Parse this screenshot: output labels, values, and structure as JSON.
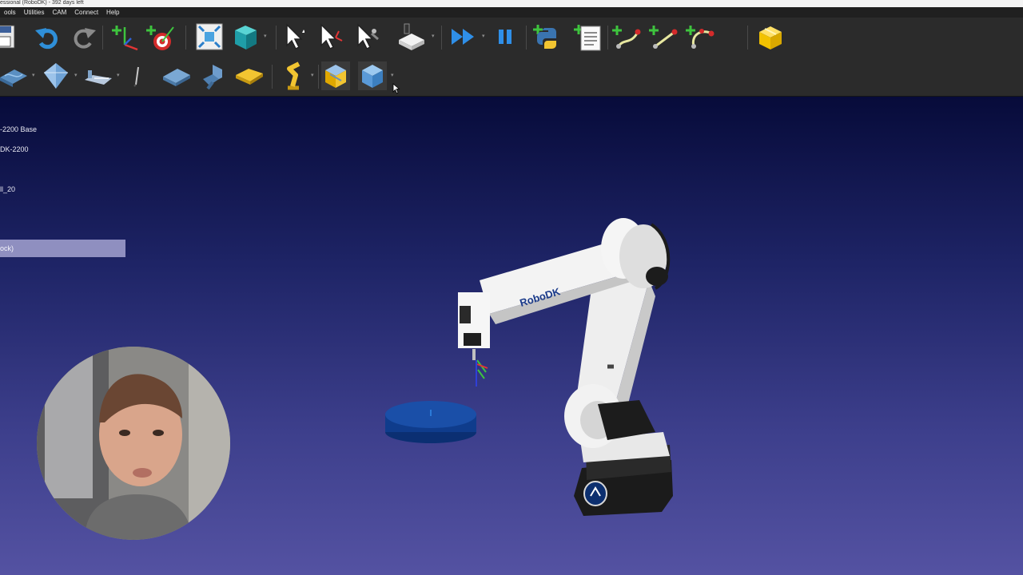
{
  "window": {
    "title": "essional (RoboDK) - 392 days left"
  },
  "menu": [
    "ools",
    "Utilities",
    "CAM",
    "Connect",
    "Help"
  ],
  "toolbar1": [
    {
      "name": "save-icon"
    },
    {
      "name": "undo-icon"
    },
    {
      "name": "redo-icon"
    },
    {
      "name": "add-reference-frame-icon"
    },
    {
      "name": "add-target-icon"
    },
    {
      "name": "fit-all-icon"
    },
    {
      "name": "iso-view-icon"
    },
    {
      "name": "select-icon"
    },
    {
      "name": "move-reference-icon"
    },
    {
      "name": "move-tcp-icon"
    },
    {
      "name": "collision-check-icon"
    },
    {
      "name": "fast-simulation-icon"
    },
    {
      "name": "pause-icon"
    },
    {
      "name": "python-icon"
    },
    {
      "name": "program-icon"
    },
    {
      "name": "move-joint-icon"
    },
    {
      "name": "move-linear-icon"
    },
    {
      "name": "move-circular-icon"
    },
    {
      "name": "package-icon"
    }
  ],
  "toolbar2": [
    {
      "name": "curve-follow-icon"
    },
    {
      "name": "surface-icon"
    },
    {
      "name": "milling-icon"
    },
    {
      "name": "drill-icon"
    },
    {
      "name": "plane-icon"
    },
    {
      "name": "tool-icon"
    },
    {
      "name": "station-icon"
    },
    {
      "name": "robot-arm-icon"
    },
    {
      "name": "box-icon"
    },
    {
      "name": "cube-icon"
    }
  ],
  "tree": {
    "items": [
      "-2200 Base",
      "DK-2200",
      "ll_20"
    ],
    "selected": "ock)"
  },
  "scene": {
    "robot_brand": "RoboDK"
  },
  "colors": {
    "toolbar_bg": "#2b2b2b",
    "view_top": "#070b3a",
    "view_bottom": "#5452a2",
    "selection": "#8f8fc0"
  }
}
